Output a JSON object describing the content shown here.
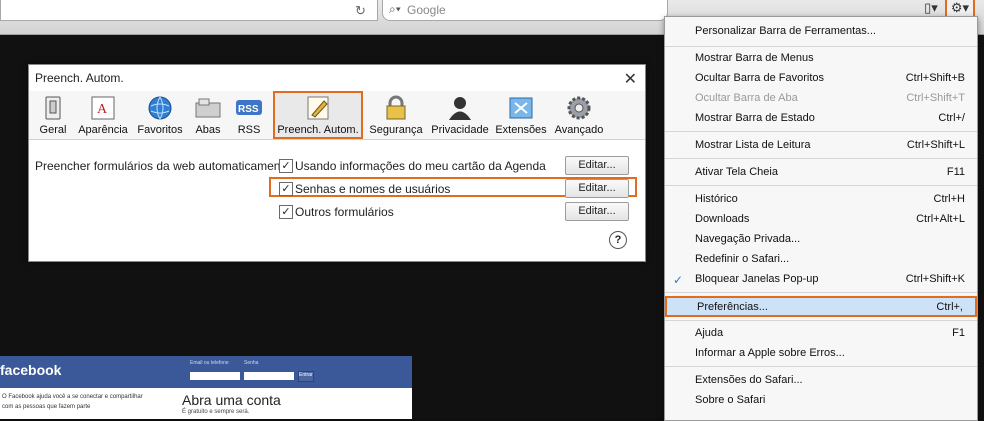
{
  "toolbar": {
    "search_placeholder": "Google",
    "reload_symbol": "↻",
    "search_symbol": "⌕▾",
    "page_symbol": "▯▾",
    "gear_symbol": "⚙▾"
  },
  "prefs": {
    "title": "Preench. Autom.",
    "close_symbol": "✕",
    "tabs": [
      {
        "label": "Geral",
        "icon": "switch-icon"
      },
      {
        "label": "Aparência",
        "icon": "font-icon"
      },
      {
        "label": "Favoritos",
        "icon": "globe-icon"
      },
      {
        "label": "Abas",
        "icon": "tabs-icon"
      },
      {
        "label": "RSS",
        "icon": "rss-icon"
      },
      {
        "label": "Preench. Autom.",
        "icon": "pencil-icon"
      },
      {
        "label": "Segurança",
        "icon": "lock-icon"
      },
      {
        "label": "Privacidade",
        "icon": "silhouette-icon"
      },
      {
        "label": "Extensões",
        "icon": "puzzle-icon"
      },
      {
        "label": "Avançado",
        "icon": "gear-icon"
      }
    ],
    "rss_text": "RSS",
    "form_label": "Preencher formulários da web automaticamente:",
    "options": [
      {
        "label": "Usando informações do meu cartão da Agenda",
        "checked": true,
        "button": "Editar..."
      },
      {
        "label": "Senhas e nomes de usuários",
        "checked": true,
        "button": "Editar..."
      },
      {
        "label": "Outros formulários",
        "checked": true,
        "button": "Editar..."
      }
    ],
    "check_mark": "✓",
    "help_symbol": "?"
  },
  "facebook": {
    "logo": "facebook",
    "email_label": "Email ou telefone",
    "password_label": "Senha",
    "enter_label": "Entrar",
    "description": "O Facebook ajuda você a se conectar e compartilhar com as pessoas que fazem parte",
    "signup_title": "Abra uma conta",
    "free_text": "É gratuito e sempre será."
  },
  "menu": {
    "check_mark": "✓",
    "items": [
      {
        "label": "Personalizar Barra de Ferramentas...",
        "shortcut": ""
      },
      {
        "label": "Mostrar Barra de Menus",
        "shortcut": ""
      },
      {
        "label": "Ocultar Barra de Favoritos",
        "shortcut": "Ctrl+Shift+B"
      },
      {
        "label": "Ocultar Barra de Aba",
        "shortcut": "Ctrl+Shift+T",
        "disabled": true
      },
      {
        "label": "Mostrar Barra de Estado",
        "shortcut": "Ctrl+/"
      },
      {
        "label": "Mostrar Lista de Leitura",
        "shortcut": "Ctrl+Shift+L"
      },
      {
        "label": "Ativar Tela Cheia",
        "shortcut": "F11"
      },
      {
        "label": "Histórico",
        "shortcut": "Ctrl+H"
      },
      {
        "label": "Downloads",
        "shortcut": "Ctrl+Alt+L"
      },
      {
        "label": "Navegação Privada...",
        "shortcut": ""
      },
      {
        "label": "Redefinir o Safari...",
        "shortcut": ""
      },
      {
        "label": "Bloquear Janelas Pop-up",
        "shortcut": "Ctrl+Shift+K",
        "checked": true
      },
      {
        "label": "Preferências...",
        "shortcut": "Ctrl+,",
        "highlighted": true
      },
      {
        "label": "Ajuda",
        "shortcut": "F1"
      },
      {
        "label": "Informar a Apple sobre Erros...",
        "shortcut": ""
      },
      {
        "label": "Extensões do Safari...",
        "shortcut": ""
      },
      {
        "label": "Sobre o Safari",
        "shortcut": ""
      }
    ]
  },
  "colors": {
    "highlight_border": "#e36b1e",
    "facebook_blue": "#3b5998",
    "menu_selection": "#cde1f7"
  }
}
